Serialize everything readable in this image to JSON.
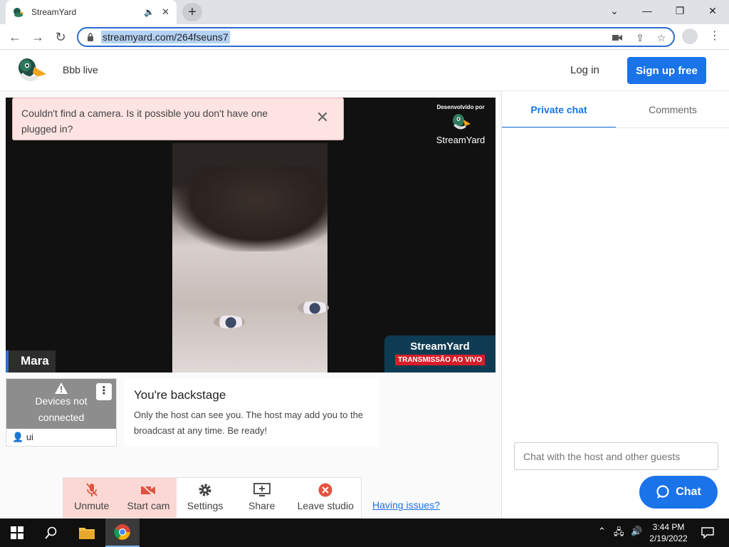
{
  "browser": {
    "tab_title": "StreamYard",
    "address": "streamyard.com/264fseuns7"
  },
  "header": {
    "studio_name": "Bbb live",
    "login_label": "Log in",
    "signup_label": "Sign up free"
  },
  "toast": {
    "message": "Couldn't find a camera. Is it possible you don't have one plugged in?"
  },
  "video": {
    "participant_name": "Mara",
    "brand_top_small": "Desenvolvido por",
    "brand_top_name": "StreamYard",
    "brand_bottom_name": "StreamYard",
    "brand_bottom_live": "TRANSMISSÃO AO VIVO"
  },
  "guest": {
    "status_line1": "Devices not",
    "status_line2": "connected",
    "name": "ui"
  },
  "backstage": {
    "heading": "You're backstage",
    "body": "Only the host can see you. The host may add you to the broadcast at any time. Be ready!"
  },
  "controls": {
    "unmute": "Unmute",
    "start_cam": "Start cam",
    "settings": "Settings",
    "share": "Share",
    "leave": "Leave studio",
    "issues": "Having issues?"
  },
  "sidebar": {
    "tabs": [
      {
        "label": "Private chat",
        "active": true
      },
      {
        "label": "Comments",
        "active": false
      }
    ],
    "chat_placeholder": "Chat with the host and other guests",
    "chat_button": "Chat"
  },
  "taskbar": {
    "time": "3:44 PM",
    "date": "2/19/2022"
  },
  "colors": {
    "accent": "#1a73e8",
    "toast_bg": "#fde3e2",
    "muted_control_bg": "#fbd8d3",
    "live_red": "#d81e2a"
  }
}
